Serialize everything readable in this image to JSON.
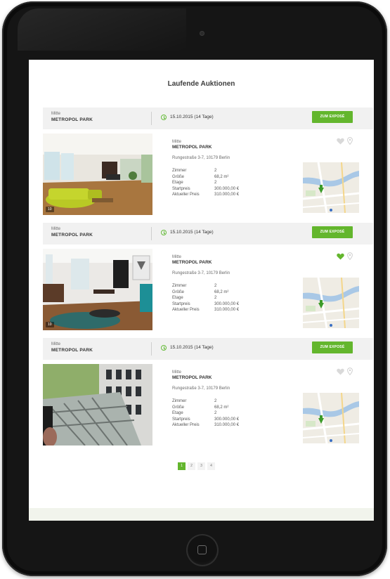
{
  "page_title": "Laufende Auktionen",
  "colors": {
    "accent": "#63b62d",
    "bar": "#f1f1f1",
    "device": "#0b0b0b"
  },
  "listings": [
    {
      "district": "Mitte",
      "name": "METROPOL PARK",
      "date": "15.10.2015 (14 Tage)",
      "button": "ZUM EXPOSÉ",
      "photo_count": "10",
      "address": "Rungestraße 3-7, 10179 Berlin",
      "favorited": false,
      "specs": [
        {
          "label": "Zimmer",
          "value": "2"
        },
        {
          "label": "Größe",
          "value": "68,2 m²"
        },
        {
          "label": "Etage",
          "value": "2"
        },
        {
          "label": "Startpreis",
          "value": "300.000,00 €"
        },
        {
          "label": "Aktueller Preis",
          "value": "310.000,00 €"
        }
      ]
    },
    {
      "district": "Mitte",
      "name": "METROPOL PARK",
      "date": "15.10.2015 (14 Tage)",
      "button": "ZUM EXPOSÉ",
      "photo_count": "10",
      "address": "Rungestraße 3-7, 10179 Berlin",
      "favorited": true,
      "specs": [
        {
          "label": "Zimmer",
          "value": "2"
        },
        {
          "label": "Größe",
          "value": "68,2 m²"
        },
        {
          "label": "Etage",
          "value": "2"
        },
        {
          "label": "Startpreis",
          "value": "300.000,00 €"
        },
        {
          "label": "Aktueller Preis",
          "value": "310.000,00 €"
        }
      ]
    },
    {
      "district": "Mitte",
      "name": "METROPOL PARK",
      "date": "15.10.2015 (14 Tage)",
      "button": "ZUM EXPOSÉ",
      "address": "Rungestraße 3-7, 10179 Berlin",
      "favorited": false,
      "specs": [
        {
          "label": "Zimmer",
          "value": "2"
        },
        {
          "label": "Größe",
          "value": "68,2 m²"
        },
        {
          "label": "Etage",
          "value": "2"
        },
        {
          "label": "Startpreis",
          "value": "300.000,00 €"
        },
        {
          "label": "Aktueller Preis",
          "value": "310.000,00 €"
        }
      ]
    }
  ],
  "pagination": {
    "pages": [
      "1",
      "2",
      "3",
      "4"
    ],
    "current": "1"
  }
}
